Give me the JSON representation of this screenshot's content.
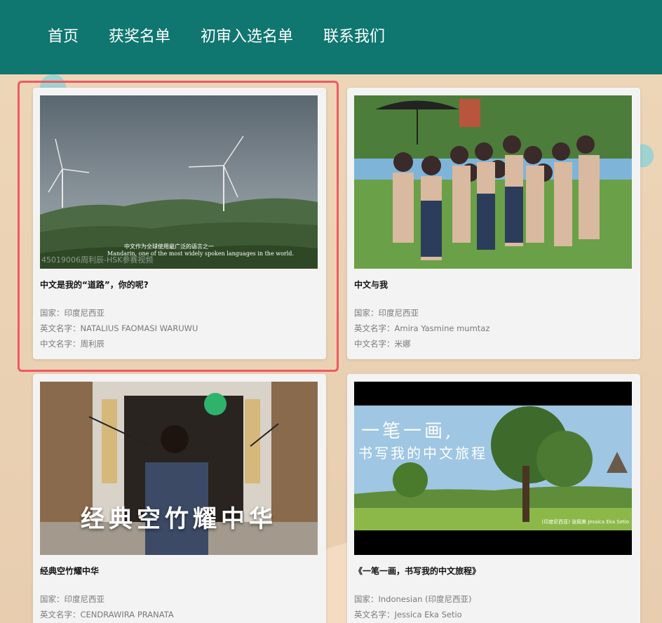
{
  "nav": {
    "items": [
      "首页",
      "获奖名单",
      "初审入选名单",
      "联系我们"
    ]
  },
  "cards": [
    {
      "title": "中文是我的“道路”，你的呢?",
      "country": "国家：印度尼西亚",
      "english_name": "英文名字：NATALIUS FAOMASI WARUWU",
      "chinese_name": "中文名字：周利辰",
      "thumb_watermark": "45019006周利辰-HSK参赛视频",
      "thumb_subtitle_cn": "中文作为全球使用最广泛的语言之一",
      "thumb_subtitle_en": "Mandarin, one of the most widely spoken languages in the world."
    },
    {
      "title": "中文与我",
      "country": "国家：印度尼西亚",
      "english_name": "英文名字：Amira Yasmine mumtaz",
      "chinese_name": "中文名字：米娜"
    },
    {
      "title": "经典空竹耀中华",
      "country": "国家：印度尼西亚",
      "english_name": "英文名字：CENDRAWIRA PRANATA",
      "thumb_caption": "经典空竹耀中华"
    },
    {
      "title": "《一笔一画，书写我的中文旅程》",
      "country": "国家：Indonesian (印度尼西亚)",
      "english_name": "英文名字：Jessica Eka Setio",
      "thumb_line1": "一笔一画,",
      "thumb_line2": "书写我的中文旅程",
      "thumb_credit": "(印度尼西亚) 张佩美 Jessica Eka Setio"
    }
  ],
  "colors": {
    "nav_bg": "#0f7670",
    "highlight": "#ee5a63",
    "card_bg": "#f4f3f3"
  }
}
